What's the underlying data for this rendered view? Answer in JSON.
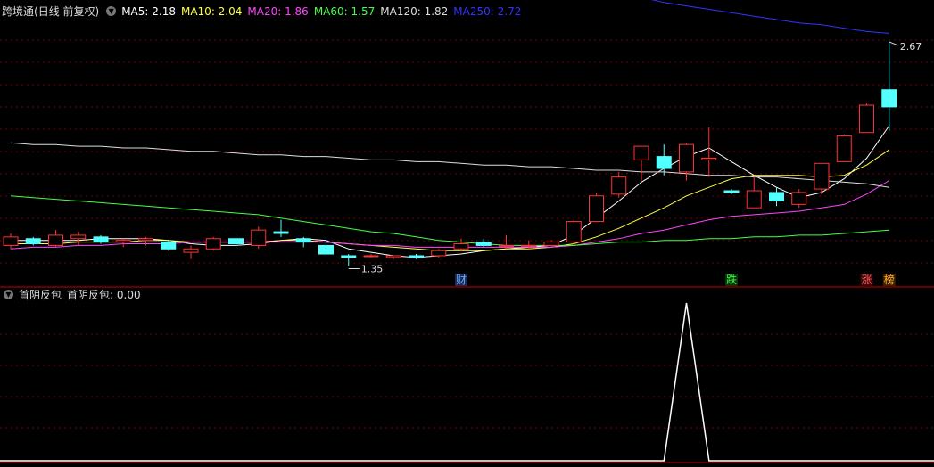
{
  "stock": {
    "name": "跨境通",
    "mode": "(日线 前复权)"
  },
  "ma_legend": [
    {
      "label": "MA5: 2.18",
      "color": "#ffffff"
    },
    {
      "label": "MA10: 2.04",
      "color": "#ffff44"
    },
    {
      "label": "MA20: 1.86",
      "color": "#ff44ff"
    },
    {
      "label": "MA60: 1.57",
      "color": "#44ff44"
    },
    {
      "label": "MA120: 1.82",
      "color": "#dddddd"
    },
    {
      "label": "MA250: 2.72",
      "color": "#3333ff"
    }
  ],
  "indicator": {
    "name": "首阴反包",
    "value_label": "首阴反包: 0.00",
    "color": "#ffffff"
  },
  "annotations": {
    "high": "2.67",
    "low": "1.35"
  },
  "colors": {
    "up": "#ff3333",
    "down": "#54ffff",
    "grid": "#7a0000",
    "axis": "#cc0000"
  },
  "chart_data": {
    "type": "candlestick",
    "price_range": [
      1.3,
      2.8
    ],
    "candles": [
      {
        "o": 1.48,
        "h": 1.55,
        "l": 1.46,
        "c": 1.53
      },
      {
        "o": 1.52,
        "h": 1.53,
        "l": 1.48,
        "c": 1.49
      },
      {
        "o": 1.48,
        "h": 1.57,
        "l": 1.47,
        "c": 1.54
      },
      {
        "o": 1.52,
        "h": 1.56,
        "l": 1.48,
        "c": 1.54
      },
      {
        "o": 1.53,
        "h": 1.54,
        "l": 1.49,
        "c": 1.5
      },
      {
        "o": 1.5,
        "h": 1.52,
        "l": 1.47,
        "c": 1.51
      },
      {
        "o": 1.51,
        "h": 1.53,
        "l": 1.48,
        "c": 1.52
      },
      {
        "o": 1.5,
        "h": 1.51,
        "l": 1.45,
        "c": 1.46
      },
      {
        "o": 1.44,
        "h": 1.48,
        "l": 1.4,
        "c": 1.46
      },
      {
        "o": 1.46,
        "h": 1.53,
        "l": 1.45,
        "c": 1.52
      },
      {
        "o": 1.52,
        "h": 1.54,
        "l": 1.47,
        "c": 1.49
      },
      {
        "o": 1.48,
        "h": 1.59,
        "l": 1.46,
        "c": 1.57
      },
      {
        "o": 1.56,
        "h": 1.63,
        "l": 1.53,
        "c": 1.55
      },
      {
        "o": 1.52,
        "h": 1.53,
        "l": 1.47,
        "c": 1.5
      },
      {
        "o": 1.48,
        "h": 1.51,
        "l": 1.43,
        "c": 1.43
      },
      {
        "o": 1.42,
        "h": 1.43,
        "l": 1.36,
        "c": 1.41
      },
      {
        "o": 1.42,
        "h": 1.43,
        "l": 1.41,
        "c": 1.42
      },
      {
        "o": 1.41,
        "h": 1.42,
        "l": 1.4,
        "c": 1.42
      },
      {
        "o": 1.42,
        "h": 1.43,
        "l": 1.4,
        "c": 1.41
      },
      {
        "o": 1.42,
        "h": 1.46,
        "l": 1.41,
        "c": 1.45
      },
      {
        "o": 1.46,
        "h": 1.52,
        "l": 1.45,
        "c": 1.49
      },
      {
        "o": 1.5,
        "h": 1.52,
        "l": 1.47,
        "c": 1.48
      },
      {
        "o": 1.48,
        "h": 1.54,
        "l": 1.46,
        "c": 1.48
      },
      {
        "o": 1.48,
        "h": 1.51,
        "l": 1.46,
        "c": 1.48
      },
      {
        "o": 1.48,
        "h": 1.51,
        "l": 1.47,
        "c": 1.5
      },
      {
        "o": 1.5,
        "h": 1.63,
        "l": 1.49,
        "c": 1.62
      },
      {
        "o": 1.62,
        "h": 1.79,
        "l": 1.62,
        "c": 1.77
      },
      {
        "o": 1.78,
        "h": 1.91,
        "l": 1.76,
        "c": 1.88
      },
      {
        "o": 1.98,
        "h": 2.04,
        "l": 1.86,
        "c": 2.06
      },
      {
        "o": 2.0,
        "h": 2.07,
        "l": 1.89,
        "c": 1.93
      },
      {
        "o": 1.91,
        "h": 2.08,
        "l": 1.86,
        "c": 2.07
      },
      {
        "o": 1.98,
        "h": 2.17,
        "l": 1.88,
        "c": 1.99
      },
      {
        "o": 1.8,
        "h": 1.81,
        "l": 1.78,
        "c": 1.79
      },
      {
        "o": 1.7,
        "h": 1.88,
        "l": 1.7,
        "c": 1.8
      },
      {
        "o": 1.79,
        "h": 1.82,
        "l": 1.71,
        "c": 1.74
      },
      {
        "o": 1.72,
        "h": 1.81,
        "l": 1.7,
        "c": 1.79
      },
      {
        "o": 1.81,
        "h": 1.96,
        "l": 1.78,
        "c": 1.96
      },
      {
        "o": 1.97,
        "h": 2.13,
        "l": 1.97,
        "c": 2.12
      },
      {
        "o": 2.14,
        "h": 2.31,
        "l": 2.14,
        "c": 2.3
      },
      {
        "o": 2.39,
        "h": 2.67,
        "l": 2.15,
        "c": 2.29
      }
    ],
    "ma": {
      "MA5": [
        1.51,
        1.51,
        1.51,
        1.51,
        1.52,
        1.52,
        1.52,
        1.51,
        1.49,
        1.48,
        1.48,
        1.49,
        1.51,
        1.52,
        1.51,
        1.46,
        1.44,
        1.42,
        1.41,
        1.42,
        1.43,
        1.45,
        1.46,
        1.47,
        1.48,
        1.54,
        1.64,
        1.74,
        1.85,
        1.93,
        2.0,
        2.05,
        1.97,
        1.89,
        1.82,
        1.76,
        1.79,
        1.87,
        1.99,
        2.18
      ],
      "MA10": [
        1.49,
        1.49,
        1.49,
        1.5,
        1.5,
        1.5,
        1.51,
        1.51,
        1.5,
        1.5,
        1.5,
        1.5,
        1.51,
        1.51,
        1.5,
        1.49,
        1.48,
        1.47,
        1.46,
        1.45,
        1.45,
        1.45,
        1.46,
        1.46,
        1.47,
        1.49,
        1.53,
        1.58,
        1.64,
        1.7,
        1.77,
        1.82,
        1.87,
        1.89,
        1.89,
        1.89,
        1.88,
        1.89,
        1.95,
        2.04
      ],
      "MA20": [
        1.46,
        1.47,
        1.47,
        1.48,
        1.48,
        1.49,
        1.49,
        1.49,
        1.5,
        1.5,
        1.5,
        1.5,
        1.5,
        1.5,
        1.5,
        1.49,
        1.48,
        1.48,
        1.47,
        1.47,
        1.47,
        1.47,
        1.47,
        1.47,
        1.47,
        1.48,
        1.5,
        1.52,
        1.55,
        1.57,
        1.6,
        1.63,
        1.65,
        1.66,
        1.67,
        1.68,
        1.7,
        1.72,
        1.78,
        1.86
      ],
      "MA60": [
        1.77,
        1.76,
        1.75,
        1.74,
        1.73,
        1.72,
        1.71,
        1.7,
        1.69,
        1.68,
        1.67,
        1.66,
        1.64,
        1.62,
        1.6,
        1.58,
        1.56,
        1.55,
        1.53,
        1.51,
        1.5,
        1.49,
        1.48,
        1.48,
        1.48,
        1.48,
        1.49,
        1.5,
        1.5,
        1.51,
        1.51,
        1.52,
        1.52,
        1.53,
        1.53,
        1.54,
        1.54,
        1.55,
        1.56,
        1.57
      ],
      "MA120": [
        2.08,
        2.07,
        2.07,
        2.06,
        2.06,
        2.05,
        2.05,
        2.04,
        2.03,
        2.03,
        2.02,
        2.01,
        2.01,
        2.0,
        2.0,
        1.99,
        1.98,
        1.98,
        1.97,
        1.97,
        1.96,
        1.95,
        1.95,
        1.94,
        1.94,
        1.93,
        1.92,
        1.92,
        1.91,
        1.91,
        1.9,
        1.89,
        1.89,
        1.88,
        1.88,
        1.87,
        1.86,
        1.85,
        1.84,
        1.82
      ],
      "MA250": [
        3.75,
        3.73,
        3.71,
        3.68,
        3.65,
        3.62,
        3.59,
        3.56,
        3.53,
        3.5,
        3.47,
        3.44,
        3.41,
        3.38,
        3.35,
        3.32,
        3.29,
        3.26,
        3.23,
        3.2,
        3.17,
        3.14,
        3.11,
        3.08,
        3.05,
        3.02,
        2.99,
        2.96,
        2.93,
        2.9,
        2.88,
        2.86,
        2.84,
        2.82,
        2.8,
        2.78,
        2.77,
        2.75,
        2.73,
        2.72
      ]
    },
    "indicator_values": [
      0,
      0,
      0,
      0,
      0,
      0,
      0,
      0,
      0,
      0,
      0,
      0,
      0,
      0,
      0,
      0,
      0,
      0,
      0,
      0,
      0,
      0,
      0,
      0,
      0,
      0,
      0,
      0,
      0,
      0,
      1,
      0,
      0,
      0,
      0,
      0,
      0,
      0,
      0,
      0
    ],
    "markers": [
      {
        "index": 20,
        "label": "财",
        "color": "#66aaff",
        "box": "#1a2a55"
      },
      {
        "index": 32,
        "label": "跌",
        "color": "#33ff33",
        "box": "#0a3310"
      },
      {
        "index": 38,
        "label": "涨",
        "color": "#ff5555",
        "box": "#3a0a0a"
      },
      {
        "index": 39,
        "label": "榜",
        "color": "#ffaa33",
        "box": "#3a2200"
      }
    ]
  }
}
